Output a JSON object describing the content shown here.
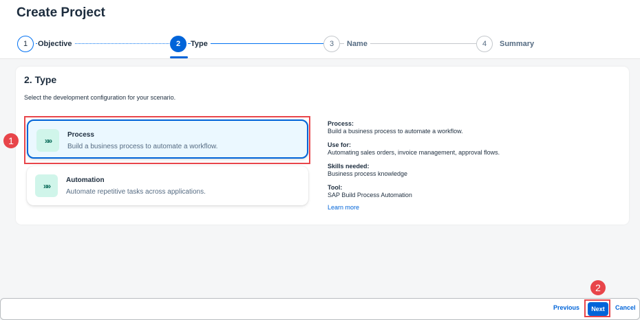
{
  "page": {
    "title": "Create Project"
  },
  "stepper": {
    "steps": [
      {
        "number": "1",
        "label": "Objective"
      },
      {
        "number": "2",
        "label": "Type"
      },
      {
        "number": "3",
        "label": "Name"
      },
      {
        "number": "4",
        "label": "Summary"
      }
    ],
    "active_step": 2
  },
  "section": {
    "title": "2. Type",
    "description": "Select the development configuration for your scenario."
  },
  "options": [
    {
      "icon": "chevrons-right-icon",
      "glyph": "»»",
      "title": "Process",
      "description": "Build a business process to automate a workflow.",
      "selected": true
    },
    {
      "icon": "chevrons-right-icon",
      "glyph": "»»",
      "title": "Automation",
      "description": "Automate repetitive tasks across applications.",
      "selected": false
    }
  ],
  "details": {
    "process_label": "Process:",
    "process_value": "Build a business process to automate a workflow.",
    "use_for_label": "Use for:",
    "use_for_value": "Automating sales orders, invoice management, approval flows.",
    "skills_label": "Skills needed:",
    "skills_value": "Business process knowledge",
    "tool_label": "Tool:",
    "tool_value": "SAP Build Process Automation",
    "learn_more": "Learn more"
  },
  "annotations": {
    "marker_1": "1",
    "marker_2": "2"
  },
  "footer": {
    "previous": "Previous",
    "next": "Next",
    "cancel": "Cancel"
  },
  "colors": {
    "accent": "#0064d9",
    "annotation": "#e8454a",
    "icon_bg": "#d0f5ea"
  }
}
